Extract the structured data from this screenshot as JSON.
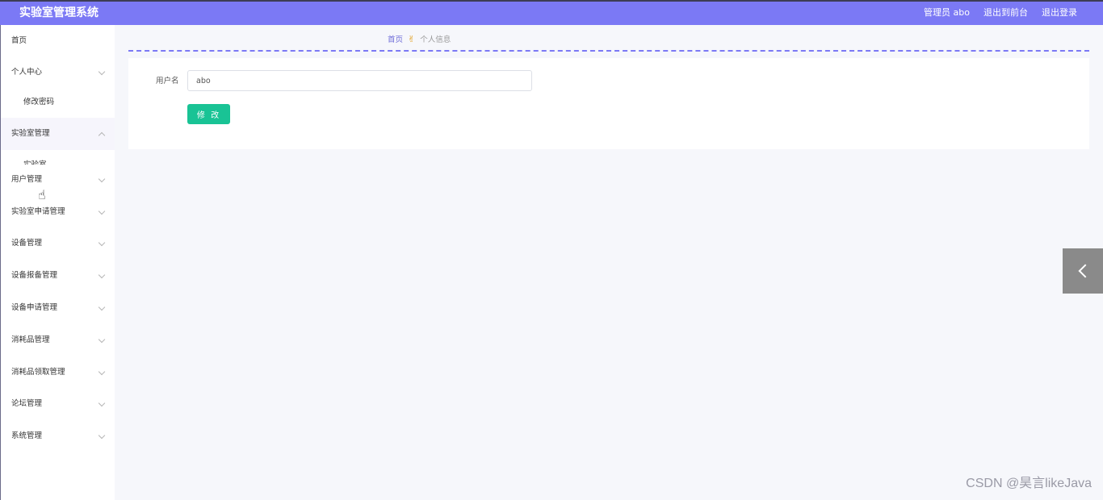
{
  "header": {
    "app_title": "实验室管理系统",
    "user_label": "管理员 abo",
    "to_front_label": "退出到前台",
    "logout_label": "退出登录"
  },
  "sidebar": {
    "home": "首页",
    "personal_center": "个人中心",
    "change_password": "修改密码",
    "lab_management": "实验室管理",
    "lab": "实验室",
    "user_management": "用户管理",
    "lab_application_management": "实验室申请管理",
    "equipment_management": "设备管理",
    "equipment_repair_management": "设备报备管理",
    "equipment_application_management": "设备申请管理",
    "consumables_management": "消耗品管理",
    "consumables_claim_management": "消耗品领取管理",
    "forum_management": "论坛管理",
    "system_management": "系统管理"
  },
  "breadcrumb": {
    "home": "首页",
    "separator": "✌",
    "current": "个人信息"
  },
  "form": {
    "username_label": "用户名",
    "username_value": "abo",
    "submit_label": "修 改"
  },
  "watermark": "CSDN @昊言likeJava",
  "icons": {
    "cursor": "hand-pointer-icon",
    "toggle": "chevron-left-icon"
  },
  "colors": {
    "header_bg": "#7b79f5",
    "submit_bg": "#19c395",
    "page_bg": "#f6f7fb"
  }
}
